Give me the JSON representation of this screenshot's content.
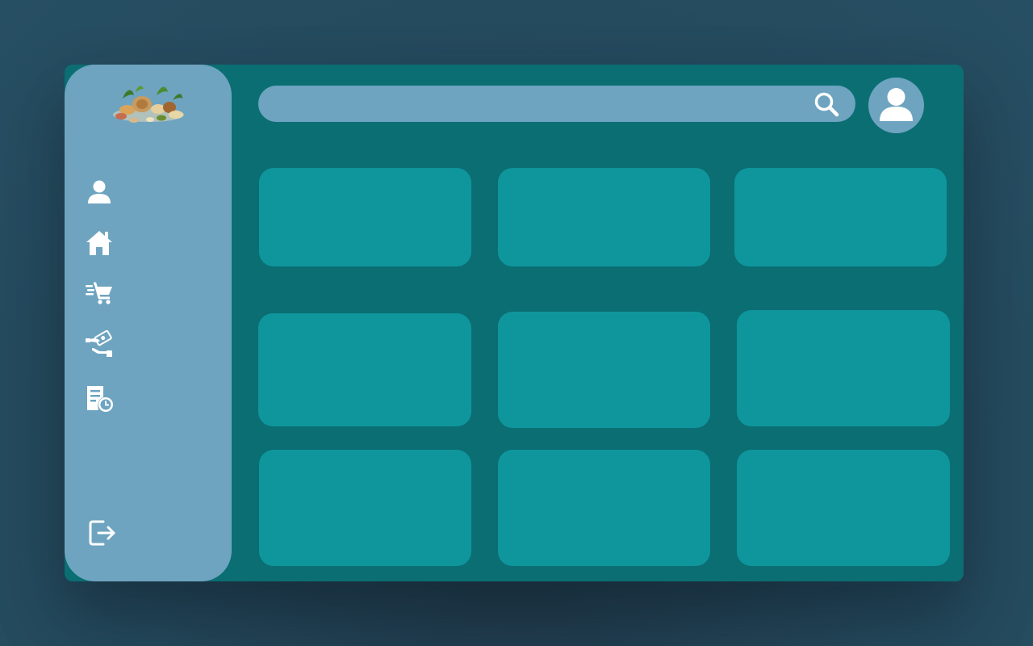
{
  "search": {
    "placeholder": ""
  },
  "icons": {
    "logo": "nuts-logo",
    "nav": [
      "user-icon",
      "home-icon",
      "fast-cart-icon",
      "payment-hand-icon",
      "report-clock-icon"
    ],
    "logout": "logout-icon",
    "search": "search-icon",
    "avatar": "user-avatar-icon"
  },
  "colors": {
    "background": "#274f63",
    "panel": "#0b6e73",
    "sidebar": "#6ea4c0",
    "card": "#0e969c",
    "icon": "#ffffff"
  },
  "cards_count": 9
}
